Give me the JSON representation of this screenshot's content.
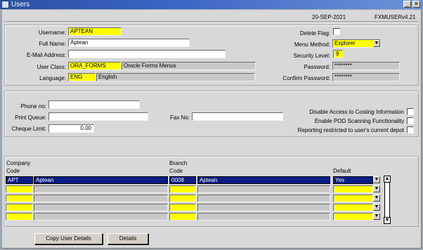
{
  "window": {
    "title": "Users"
  },
  "header": {
    "date": "20-SEP-2021",
    "module": "FXMUSER",
    "version": "v4.21"
  },
  "user": {
    "username_label": "Username:",
    "username": "APTEAN",
    "fullname_label": "Full Name:",
    "fullname": "Aptean",
    "email_label": "E-Mail Address:",
    "email": "",
    "userclass_label": "User Class:",
    "userclass_code": "ORA_FORMS",
    "userclass_desc": "Oracle Forms Menus",
    "language_label": "Language:",
    "language_code": "ENG",
    "language_desc": "English",
    "delete_flag_label": "Delete Flag:",
    "menu_method_label": "Menu Method:",
    "menu_method": "Explorer",
    "security_level_label": "Security Level:",
    "security_level": "9",
    "password_label": "Password:",
    "password": "********",
    "confirm_password_label": "Confirm Password:",
    "confirm_password": "********"
  },
  "contact": {
    "phone_label": "Phone no:",
    "phone": "",
    "print_queue_label": "Print Queue:",
    "print_queue": "",
    "cheque_limit_label": "Cheque Limit:",
    "cheque_limit": "0.00",
    "fax_label": "Fax No:",
    "fax": "",
    "disable_costing_label": "Disable Access to Costing Information",
    "enable_pod_label": "Enable POD Scanning Functionality",
    "restrict_depot_label": "Reporting restricted to user's current depot"
  },
  "grid": {
    "company_header_1": "Company",
    "company_header_2": "Code",
    "branch_header_1": "Branch",
    "branch_header_2": "Code",
    "default_header": "Default",
    "row1": {
      "company_code": "APT",
      "company_name": "Aptean",
      "branch_code": "0008",
      "branch_name": "Aptean",
      "default": "Yes"
    }
  },
  "buttons": {
    "copy_user_details": "Copy User Details",
    "details": "Details"
  },
  "icons": {
    "app": "app-window-icon",
    "minimize": "minimize-icon",
    "close": "close-icon",
    "dropdown": "chevron-down-icon",
    "scroll_up": "arrow-up-icon",
    "scroll_down": "arrow-down-icon"
  }
}
